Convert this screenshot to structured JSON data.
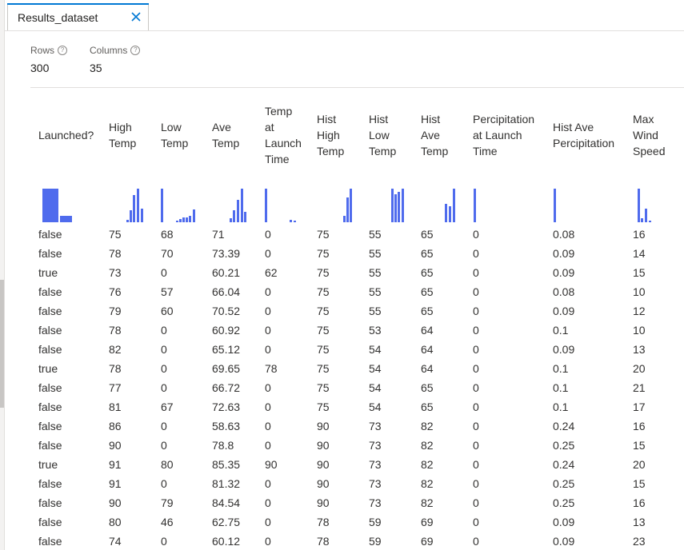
{
  "tab": {
    "title": "Results_dataset"
  },
  "stats": [
    {
      "label": "Rows",
      "value": "300"
    },
    {
      "label": "Columns",
      "value": "35"
    }
  ],
  "colors": {
    "accent": "#0078d4",
    "histogram": "#4f6bed",
    "text": "#323130"
  },
  "columns": [
    {
      "key": "launched",
      "lines": [
        "Launched?"
      ]
    },
    {
      "key": "high_temp",
      "lines": [
        "High",
        "Temp"
      ]
    },
    {
      "key": "low_temp",
      "lines": [
        "Low",
        "Temp"
      ]
    },
    {
      "key": "ave_temp",
      "lines": [
        "Ave",
        "Temp"
      ]
    },
    {
      "key": "temp_launch",
      "lines": [
        "Temp",
        "at",
        "Launch",
        "Time"
      ]
    },
    {
      "key": "hist_high_temp",
      "lines": [
        "Hist",
        "High",
        "Temp"
      ]
    },
    {
      "key": "hist_low_temp",
      "lines": [
        "Hist",
        "Low",
        "Temp"
      ]
    },
    {
      "key": "hist_ave_temp",
      "lines": [
        "Hist",
        "Ave",
        "Temp"
      ]
    },
    {
      "key": "precip_launch",
      "lines": [
        "Percipitation",
        "at Launch",
        "Time"
      ]
    },
    {
      "key": "hist_ave_precip",
      "lines": [
        "Hist Ave",
        "Percipitation"
      ]
    },
    {
      "key": "max_wind",
      "lines": [
        "Max",
        "Wind",
        "Speed"
      ]
    }
  ],
  "histograms": [
    [
      1.0,
      0.18
    ],
    [
      0.08,
      0.35,
      0.82,
      1.0,
      0.4
    ],
    [
      1.0,
      0.03,
      0.1,
      0.14,
      0.14,
      0.2,
      0.38
    ],
    [
      0.12,
      0.35,
      0.66,
      1.0,
      0.32
    ],
    [
      1.0,
      0.06,
      0.04
    ],
    [
      0.2,
      0.74,
      1.0
    ],
    [
      1.0,
      0.83,
      0.9,
      1.0
    ],
    [
      0.54,
      0.48,
      1.0
    ],
    [
      1.0
    ],
    [
      1.0
    ],
    [
      1.0,
      0.12,
      0.4,
      0.05
    ]
  ],
  "rows": [
    [
      "false",
      "75",
      "68",
      "71",
      "0",
      "75",
      "55",
      "65",
      "0",
      "0.08",
      "16"
    ],
    [
      "false",
      "78",
      "70",
      "73.39",
      "0",
      "75",
      "55",
      "65",
      "0",
      "0.09",
      "14"
    ],
    [
      "true",
      "73",
      "0",
      "60.21",
      "62",
      "75",
      "55",
      "65",
      "0",
      "0.09",
      "15"
    ],
    [
      "false",
      "76",
      "57",
      "66.04",
      "0",
      "75",
      "55",
      "65",
      "0",
      "0.08",
      "10"
    ],
    [
      "false",
      "79",
      "60",
      "70.52",
      "0",
      "75",
      "55",
      "65",
      "0",
      "0.09",
      "12"
    ],
    [
      "false",
      "78",
      "0",
      "60.92",
      "0",
      "75",
      "53",
      "64",
      "0",
      "0.1",
      "10"
    ],
    [
      "false",
      "82",
      "0",
      "65.12",
      "0",
      "75",
      "54",
      "64",
      "0",
      "0.09",
      "13"
    ],
    [
      "true",
      "78",
      "0",
      "69.65",
      "78",
      "75",
      "54",
      "64",
      "0",
      "0.1",
      "20"
    ],
    [
      "false",
      "77",
      "0",
      "66.72",
      "0",
      "75",
      "54",
      "65",
      "0",
      "0.1",
      "21"
    ],
    [
      "false",
      "81",
      "67",
      "72.63",
      "0",
      "75",
      "54",
      "65",
      "0",
      "0.1",
      "17"
    ],
    [
      "false",
      "86",
      "0",
      "58.63",
      "0",
      "90",
      "73",
      "82",
      "0",
      "0.24",
      "16"
    ],
    [
      "false",
      "90",
      "0",
      "78.8",
      "0",
      "90",
      "73",
      "82",
      "0",
      "0.25",
      "15"
    ],
    [
      "true",
      "91",
      "80",
      "85.35",
      "90",
      "90",
      "73",
      "82",
      "0",
      "0.24",
      "20"
    ],
    [
      "false",
      "91",
      "0",
      "81.32",
      "0",
      "90",
      "73",
      "82",
      "0",
      "0.25",
      "15"
    ],
    [
      "false",
      "90",
      "79",
      "84.54",
      "0",
      "90",
      "73",
      "82",
      "0",
      "0.25",
      "16"
    ],
    [
      "false",
      "80",
      "46",
      "62.75",
      "0",
      "78",
      "59",
      "69",
      "0",
      "0.09",
      "13"
    ],
    [
      "false",
      "74",
      "0",
      "60.12",
      "0",
      "78",
      "59",
      "69",
      "0",
      "0.09",
      "23"
    ]
  ]
}
